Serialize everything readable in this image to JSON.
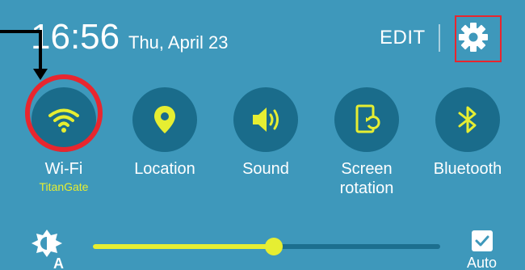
{
  "header": {
    "time": "16:56",
    "date": "Thu, April 23",
    "edit_label": "EDIT"
  },
  "quick_settings": [
    {
      "label": "Wi-Fi",
      "sub": "TitanGate",
      "icon": "wifi-icon"
    },
    {
      "label": "Location",
      "sub": "",
      "icon": "location-pin-icon"
    },
    {
      "label": "Sound",
      "sub": "",
      "icon": "speaker-icon"
    },
    {
      "label": "Screen",
      "label2": "rotation",
      "sub": "",
      "icon": "screen-rotation-icon"
    },
    {
      "label": "Bluetooth",
      "sub": "",
      "icon": "bluetooth-icon"
    }
  ],
  "brightness": {
    "level": 0.52,
    "auto_label": "Auto",
    "auto_checked": true
  },
  "colors": {
    "panel": "#3e98bb",
    "tile": "#1a6c8b",
    "active": "#e6ee32",
    "annotation": "#e8262e"
  }
}
